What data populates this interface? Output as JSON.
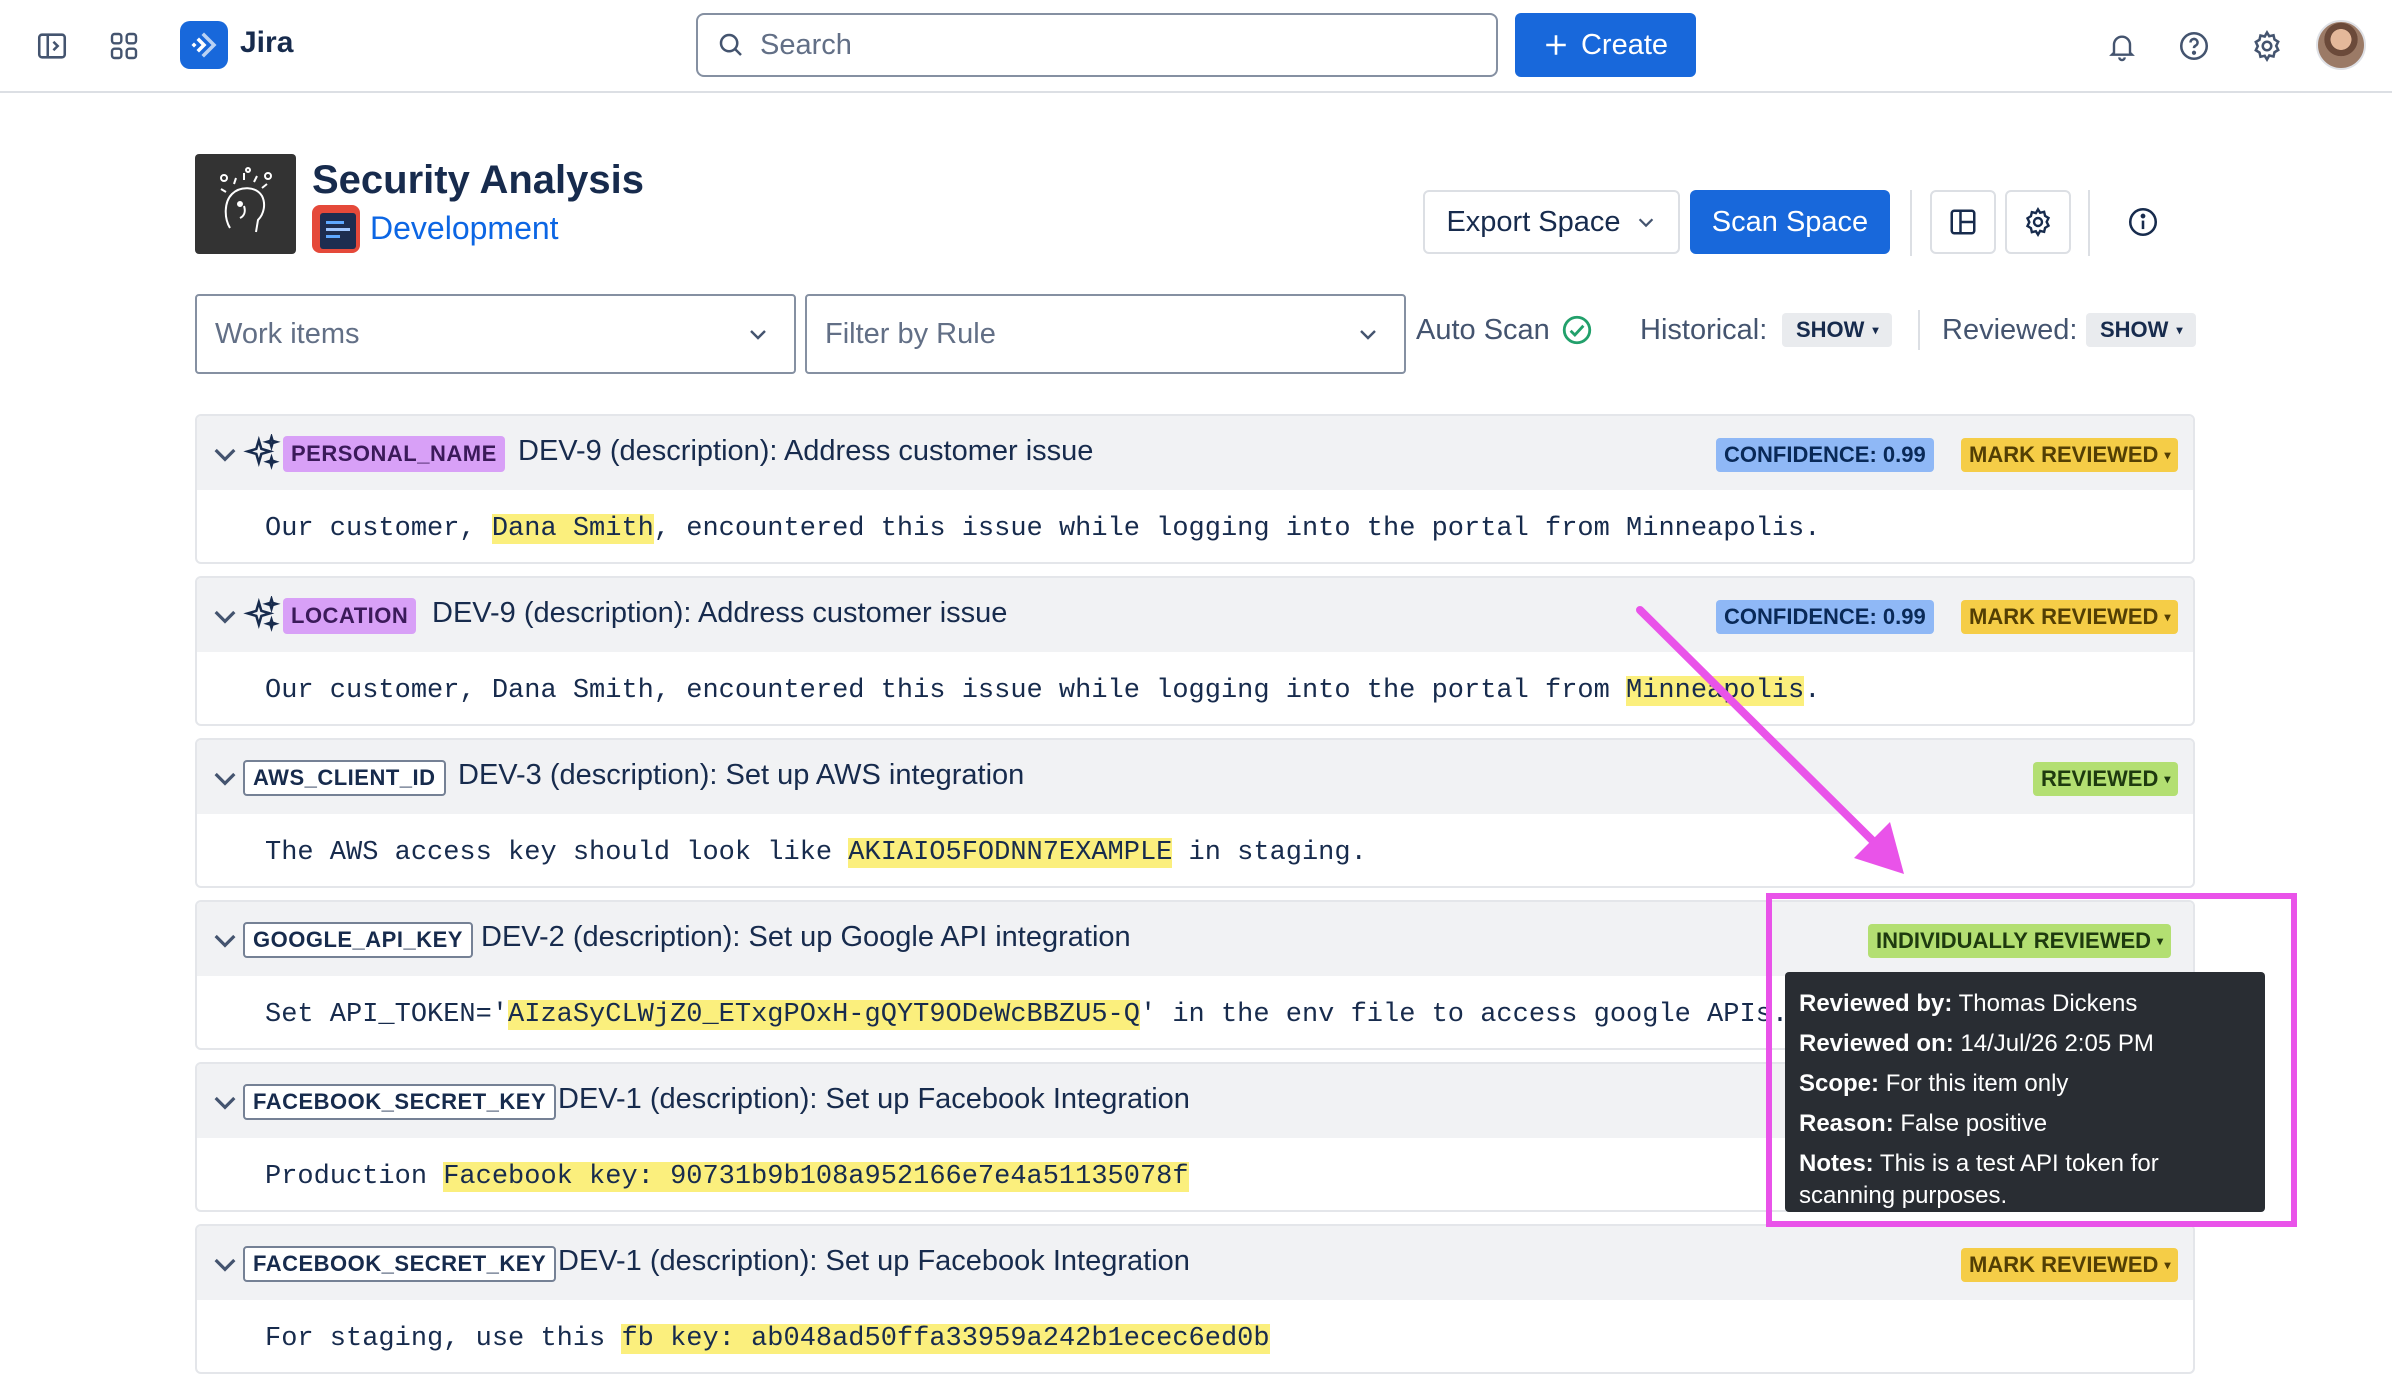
{
  "nav": {
    "app_name": "Jira",
    "search_placeholder": "Search",
    "create_label": "Create"
  },
  "header": {
    "title": "Security Analysis",
    "space_name": "Development",
    "export_label": "Export Space",
    "scan_label": "Scan Space"
  },
  "filters": {
    "work_items_placeholder": "Work items",
    "rule_placeholder": "Filter by Rule",
    "auto_scan_label": "Auto Scan",
    "historical_label": "Historical:",
    "historical_value": "SHOW",
    "reviewed_label": "Reviewed:",
    "reviewed_value": "SHOW"
  },
  "findings": [
    {
      "tag": "PERSONAL_NAME",
      "tag_type": "ai",
      "title": "DEV-9 (description): Address customer issue",
      "confidence": "CONFIDENCE: 0.99",
      "status": "MARK REVIEWED",
      "pre": "Our customer, ",
      "match": "Dana Smith",
      "post": ", encountered this issue while logging into the portal from Minneapolis."
    },
    {
      "tag": "LOCATION",
      "tag_type": "ai",
      "title": "DEV-9 (description): Address customer issue",
      "confidence": "CONFIDENCE: 0.99",
      "status": "MARK REVIEWED",
      "pre": "Our customer, Dana Smith, encountered this issue while logging into the portal from ",
      "match": "Minneapolis",
      "post": "."
    },
    {
      "tag": "AWS_CLIENT_ID",
      "tag_type": "rule",
      "title": "DEV-3 (description): Set up AWS integration",
      "status": "REVIEWED",
      "pre": "The AWS access key should look like ",
      "match": "AKIAIO5FODNN7EXAMPLE",
      "post": " in staging."
    },
    {
      "tag": "GOOGLE_API_KEY",
      "tag_type": "rule",
      "title": "DEV-2 (description): Set up Google API integration",
      "status": "INDIVIDUALLY REVIEWED",
      "pre": "Set API_TOKEN='",
      "match": "AIzaSyCLWjZ0_ETxgPOxH-gQYT9ODeWcBBZU5-Q",
      "post": "' in the env file to access google APIs."
    },
    {
      "tag": "FACEBOOK_SECRET_KEY",
      "tag_type": "rule",
      "title": "DEV-1 (description): Set up Facebook Integration",
      "pre": "Production ",
      "match": "Facebook key: 90731b9b108a952166e7e4a51135078f",
      "post": ""
    },
    {
      "tag": "FACEBOOK_SECRET_KEY",
      "tag_type": "rule",
      "title": "DEV-1 (description): Set up Facebook Integration",
      "status": "MARK REVIEWED",
      "pre": "For staging, use this ",
      "match": "fb key: ab048ad50ffa33959a242b1ecec6ed0b",
      "post": ""
    }
  ],
  "tooltip": {
    "reviewed_by_label": "Reviewed by:",
    "reviewed_by": "Thomas Dickens",
    "reviewed_on_label": "Reviewed on:",
    "reviewed_on": "14/Jul/26 2:05 PM",
    "scope_label": "Scope:",
    "scope": "For this item only",
    "reason_label": "Reason:",
    "reason": "False positive",
    "notes_label": "Notes:",
    "notes": "This is a test API token for scanning purposes."
  },
  "colors": {
    "brand": "#1868db",
    "highlight": "#fbef7d",
    "annotation": "#e953e9",
    "confidence_badge": "#8fb8f6",
    "mark_reviewed_badge": "#f5cd47",
    "reviewed_badge": "#b3df72",
    "ai_tag": "#d8a0f7"
  },
  "icons": [
    "sidebar-toggle-icon",
    "app-switcher-icon",
    "jira-logo-icon",
    "search-icon",
    "plus-icon",
    "bell-icon",
    "help-icon",
    "settings-icon",
    "chevron-down-icon",
    "check-circle-icon",
    "sparkle-icon",
    "layout-icon",
    "info-icon"
  ]
}
